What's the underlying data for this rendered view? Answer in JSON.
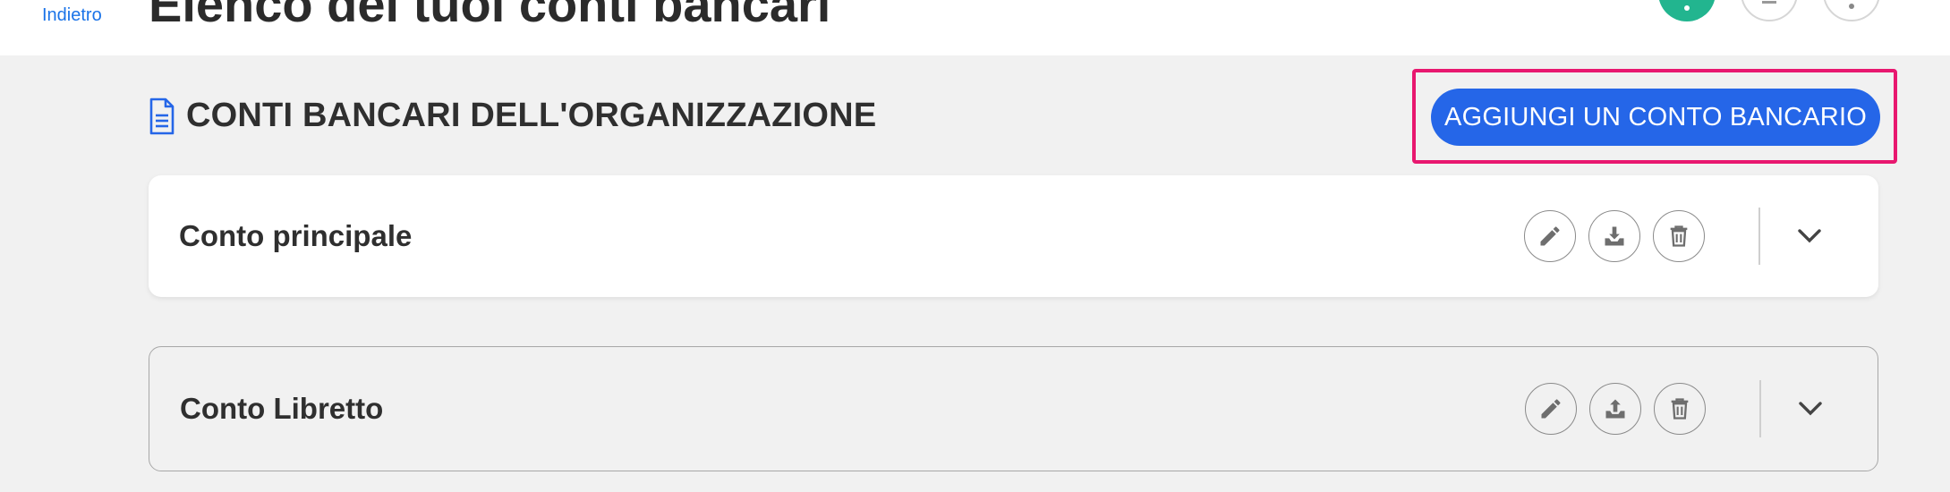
{
  "header": {
    "back_label": "Indietro",
    "page_title": "Elenco dei tuoi conti bancari"
  },
  "section": {
    "title": "CONTI BANCARI DELL'ORGANIZZAZIONE",
    "add_button_label": "AGGIUNGI UN CONTO BANCARIO"
  },
  "accounts": [
    {
      "name": "Conto principale",
      "actions": [
        "pencil-icon",
        "download-tray-icon",
        "trash-icon"
      ]
    },
    {
      "name": "Conto Libretto",
      "actions": [
        "pencil-icon",
        "upload-tray-icon",
        "trash-icon"
      ]
    }
  ],
  "colors": {
    "accent": "#2566e8",
    "highlight": "#e8186f",
    "add_fab": "#22b58f",
    "link": "#1a73e8"
  }
}
